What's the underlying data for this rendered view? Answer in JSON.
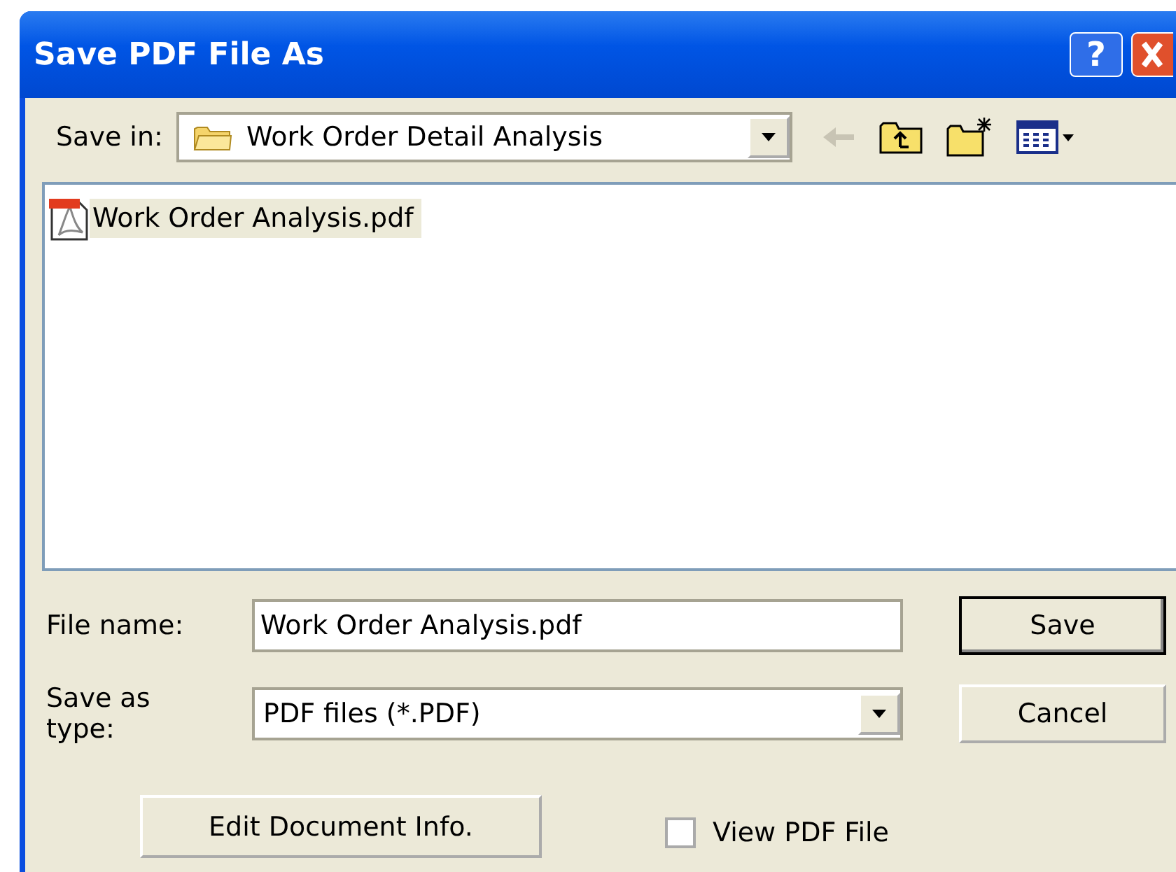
{
  "window": {
    "title": "Save PDF File As",
    "help_label": "?"
  },
  "save_in": {
    "label": "Save in:",
    "value": "Work Order Detail Analysis"
  },
  "toolbar": [
    {
      "kind": "back",
      "disabled": true
    },
    {
      "kind": "up",
      "disabled": false
    },
    {
      "kind": "new_folder",
      "disabled": false
    },
    {
      "kind": "view_menu",
      "disabled": false
    }
  ],
  "files": [
    {
      "name": "Work Order Analysis.pdf",
      "selected": true
    }
  ],
  "file_name": {
    "label": "File name:",
    "value": "Work Order Analysis.pdf"
  },
  "save_as_type": {
    "label": "Save as type:",
    "value": "PDF files (*.PDF)"
  },
  "buttons": [
    {
      "label": "Save",
      "default": true
    },
    {
      "label": "Cancel",
      "default": false
    }
  ],
  "edit_info_button": "Edit Document Info.",
  "view_pdf": {
    "label": "View PDF File",
    "checked": false
  }
}
